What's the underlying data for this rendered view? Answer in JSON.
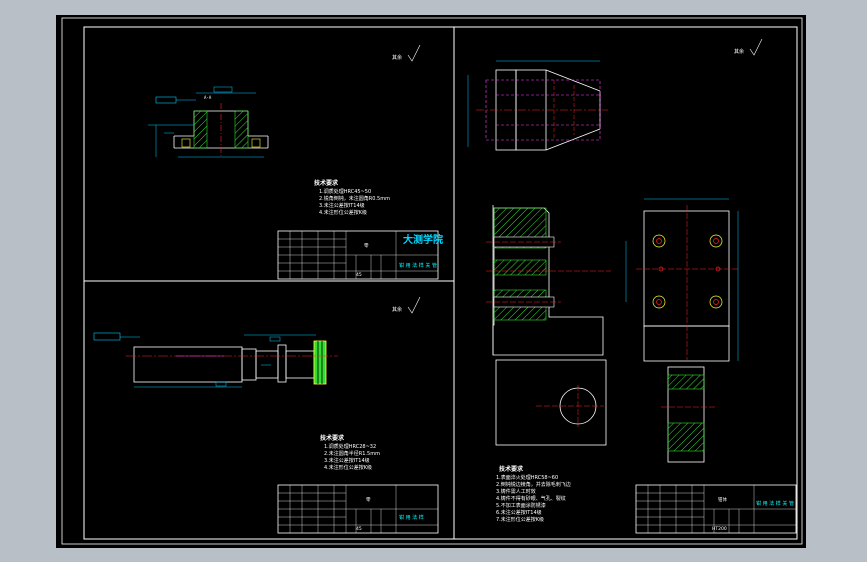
{
  "colors": {
    "background": "#b9bfc6",
    "sheet": "#000000",
    "outline": "#ffffff",
    "centerline": "#ff2020",
    "hidden": "#ff40ff",
    "dimension": "#00ccff",
    "hatch": "#33dd33",
    "special": "#00ffff",
    "yellow": "#ffff33"
  },
  "roughness_marks": {
    "top_left": "其余",
    "middle_left": "其余",
    "top_right": "其余"
  },
  "notes_1": {
    "title": "技术要求",
    "items": [
      "1.调质处理HRC45~50",
      "2.锐角倒钝，未注圆角R0.5mm",
      "3.未注公差按IT14级",
      "4.未注形位公差按K级"
    ]
  },
  "notes_2": {
    "title": "技术要求",
    "items": [
      "1.调质处理HRC28~32",
      "2.未注圆角半径R1.5mm",
      "3.未注公差按IT14级",
      "4.未注形位公差按K级"
    ]
  },
  "notes_3": {
    "title": "技术要求",
    "items": [
      "1.表面淬火处理HRC58~60",
      "2.倒钝锐边棱角，并去除毛刺飞边",
      "3.铸件需人工时效",
      "4.铸件不得有砂眼、气孔、裂纹",
      "5.不加工表面涂防锈漆",
      "6.未注公差按IT14级",
      "7.未注形位公差按K级"
    ]
  },
  "title_block_1": {
    "school": "大测学院",
    "part": "零",
    "material": "45",
    "drawing_no": "钳 用 法 样 关 管"
  },
  "title_block_2": {
    "part": "零",
    "material": "45",
    "drawing_no": "钳 用 法 样"
  },
  "title_block_3": {
    "part": "钳体",
    "material": "HT200",
    "drawing_no": "钳 用 法 样 关 管"
  }
}
